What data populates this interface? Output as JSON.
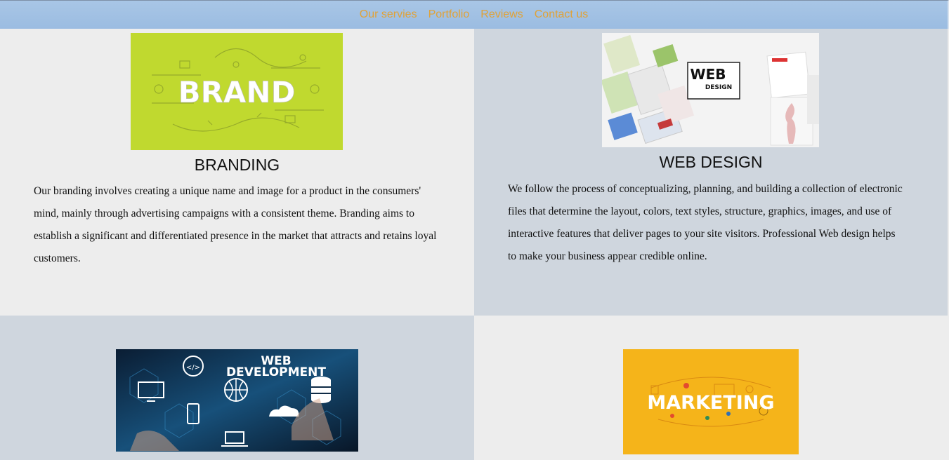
{
  "nav": {
    "links": [
      "Our servies",
      "Portfolio",
      "Reviews",
      "Contact us"
    ]
  },
  "services": [
    {
      "image_text": "BRAND",
      "title": "BRANDING",
      "description": "Our branding involves creating a unique name and image for a product in the consumers' mind, mainly through advertising campaigns with a consistent theme. Branding aims to establish a significant and differentiated presence in the market that attracts and retains loyal customers."
    },
    {
      "image_text_line1": "WEB",
      "image_text_line2": "DESIGN",
      "title": "WEB DESIGN",
      "description": "We follow the process of conceptualizing, planning, and building a collection of electronic files that determine the layout, colors, text styles, structure, graphics, images, and use of interactive features that deliver pages to your site visitors. Professional Web design helps to make your business appear credible online."
    },
    {
      "image_text_line1": "WEB",
      "image_text_line2": "DEVELOPMENT"
    },
    {
      "image_text": "MARKETING"
    }
  ],
  "colors": {
    "nav_link": "#e0a238",
    "brand_bg": "#c0d92f",
    "marketing_bg": "#f5b41a",
    "webdev_bg": "#0e2a45"
  }
}
